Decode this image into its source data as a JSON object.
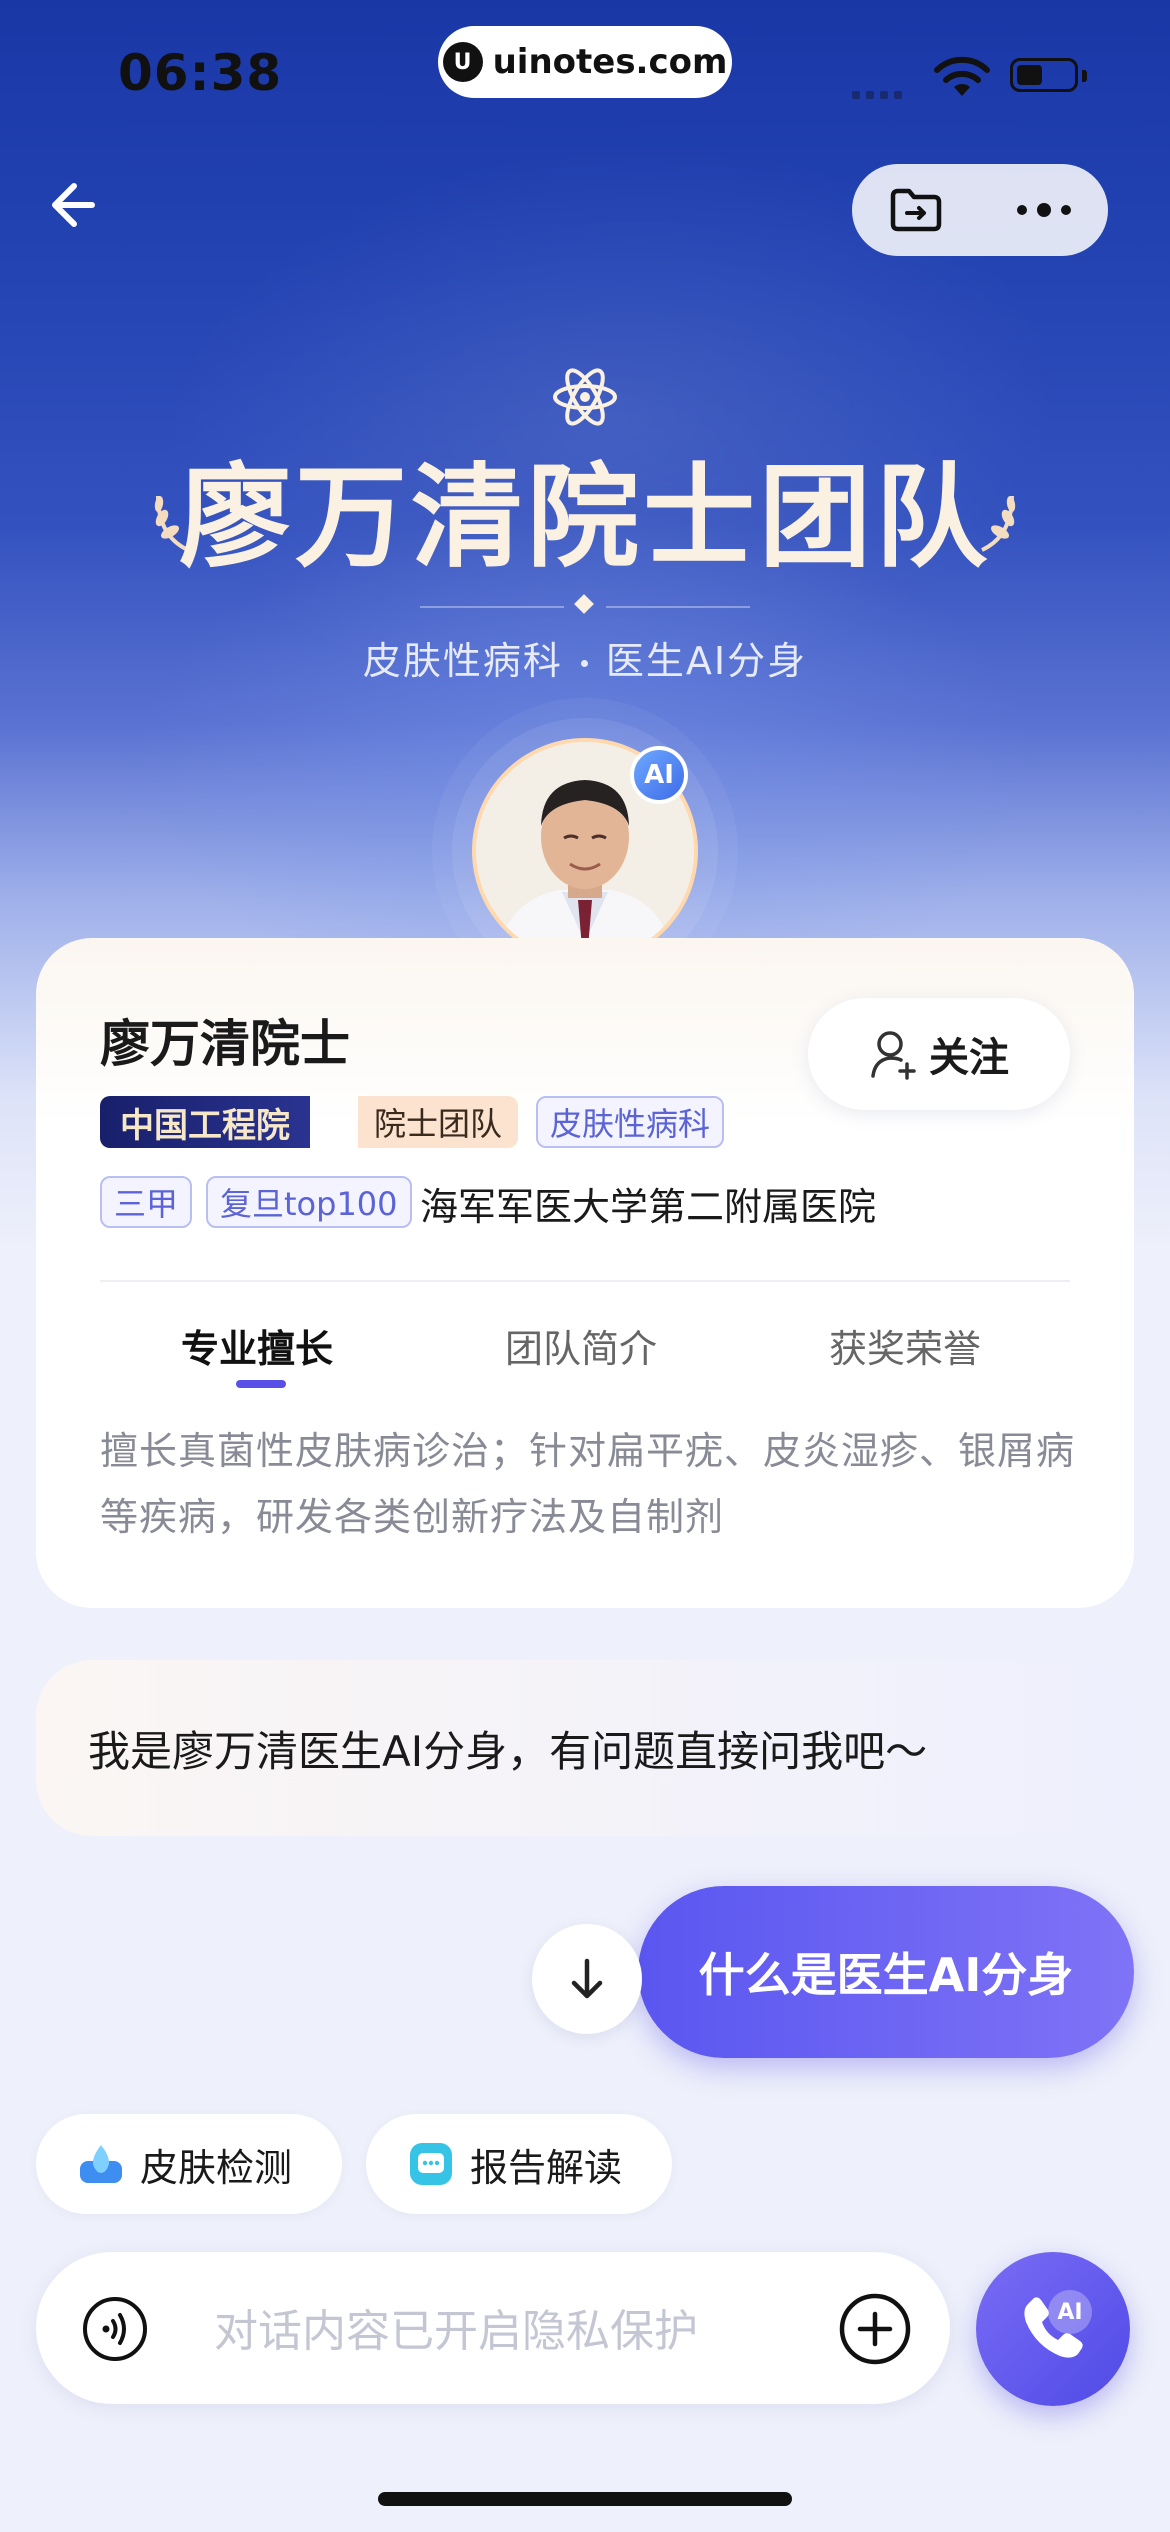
{
  "status_bar": {
    "time": "06:38",
    "url": "uinotes.com",
    "battery_level": 0.45
  },
  "header": {
    "back_icon": "arrow-left-icon",
    "capsule_icons": [
      "folder-refresh-icon",
      "more-dots-icon"
    ]
  },
  "hero": {
    "icon": "atom-icon",
    "title": "廖万清院士团队",
    "subtitle_left": "皮肤性病科",
    "subtitle_right": "医生AI分身",
    "avatar_badge": "AI"
  },
  "profile": {
    "name": "廖万清院士",
    "follow_label": "关注",
    "tag_academy": "中国工程院",
    "tag_team": "院士团队",
    "tag_dept": "皮肤性病科",
    "tag_grade": "三甲",
    "tag_rank": "复旦top100",
    "hospital": "海军军医大学第二附属医院",
    "tabs": [
      {
        "label": "专业擅长",
        "active": true
      },
      {
        "label": "团队简介",
        "active": false
      },
      {
        "label": "获奖荣誉",
        "active": false
      }
    ],
    "tab_content": "擅长真菌性皮肤病诊治；针对扁平疣、皮炎湿疹、银屑病等疾病，研发各类创新疗法及自制剂"
  },
  "chat": {
    "bot_message": "我是廖万清医生AI分身，有问题直接问我吧～",
    "user_message": "什么是医生AI分身"
  },
  "quick_actions": [
    {
      "label": "皮肤检测",
      "icon": "skin-drop-icon"
    },
    {
      "label": "报告解读",
      "icon": "report-chat-icon"
    }
  ],
  "input": {
    "placeholder": "对话内容已开启隐私保护",
    "value": ""
  },
  "call_button": {
    "badge": "AI"
  },
  "colors": {
    "accent": "#5a50e8",
    "hero_blue": "#2444b4",
    "title_gold": "#fbf1e2"
  }
}
